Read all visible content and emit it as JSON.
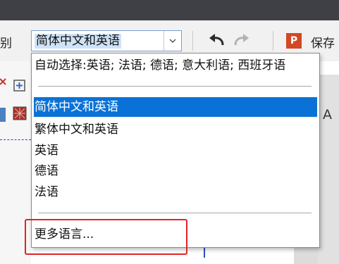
{
  "toolbar": {
    "left_label": "别",
    "language_combo": {
      "selected": "简体中文和英语"
    },
    "save_label": "保存",
    "save_icon_letter": "P"
  },
  "dropdown": {
    "auto_item": "自动选择:英语; 法语; 德语; 意大利语; 西班牙语",
    "items": [
      "简体中文和英语",
      "繁体中文和英语",
      "英语",
      "德语",
      "法语"
    ],
    "selected_index": 0,
    "more_item": "更多语言..."
  },
  "side": {
    "right_glyph": "A"
  },
  "colors": {
    "selection": "#0a72d6",
    "highlight_box": "#e02424",
    "titlebar": "#3f4045",
    "save_icon": "#d24726"
  }
}
